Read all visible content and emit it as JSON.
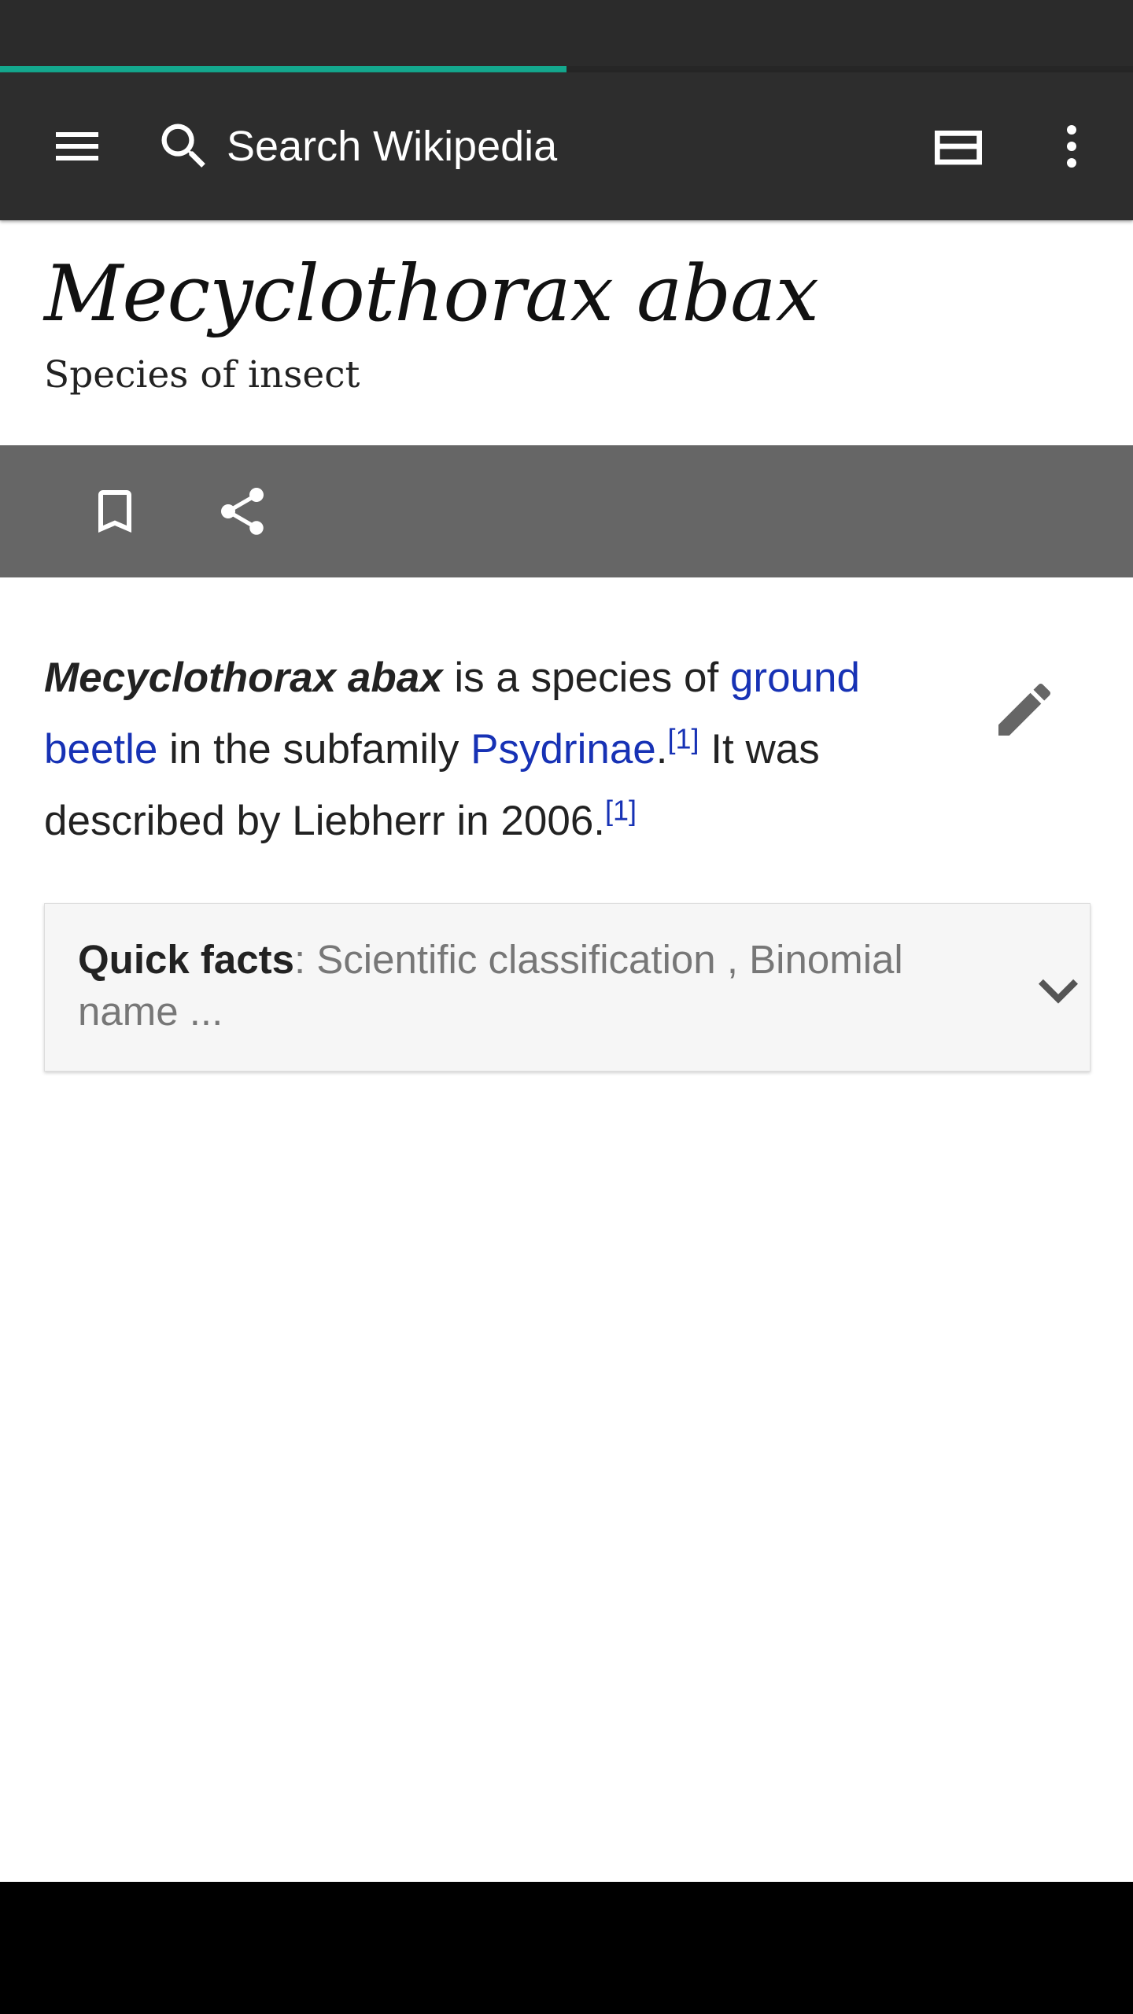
{
  "progress": {
    "fraction": 0.5
  },
  "toolbar": {
    "search_placeholder": "Search Wikipedia"
  },
  "article": {
    "title": "Mecyclothorax abax",
    "description": "Species of insect",
    "lead": {
      "subject": "Mecyclothorax abax",
      "text_1": " is a species of ",
      "link_1": "ground beetle",
      "text_2": " in the subfamily ",
      "link_2": "Psydrinae",
      "text_3": ".",
      "ref_1": "[1]",
      "text_4": " It was described by Liebherr in 2006.",
      "ref_2": "[1]"
    }
  },
  "quick_facts": {
    "label": "Quick facts",
    "summary": ": Scientific classification , Binomial name ..."
  },
  "colors": {
    "accent": "#14a88e",
    "link": "#1732b5",
    "app_bar": "#2d2d2d",
    "action_bar": "#666666"
  },
  "icons": {
    "menu": "menu-icon",
    "search": "search-icon",
    "reading_lists": "reading-lists-icon",
    "more": "more-vert-icon",
    "bookmark": "bookmark-icon",
    "share": "share-icon",
    "edit": "edit-pencil-icon",
    "expand": "chevron-down-icon"
  }
}
